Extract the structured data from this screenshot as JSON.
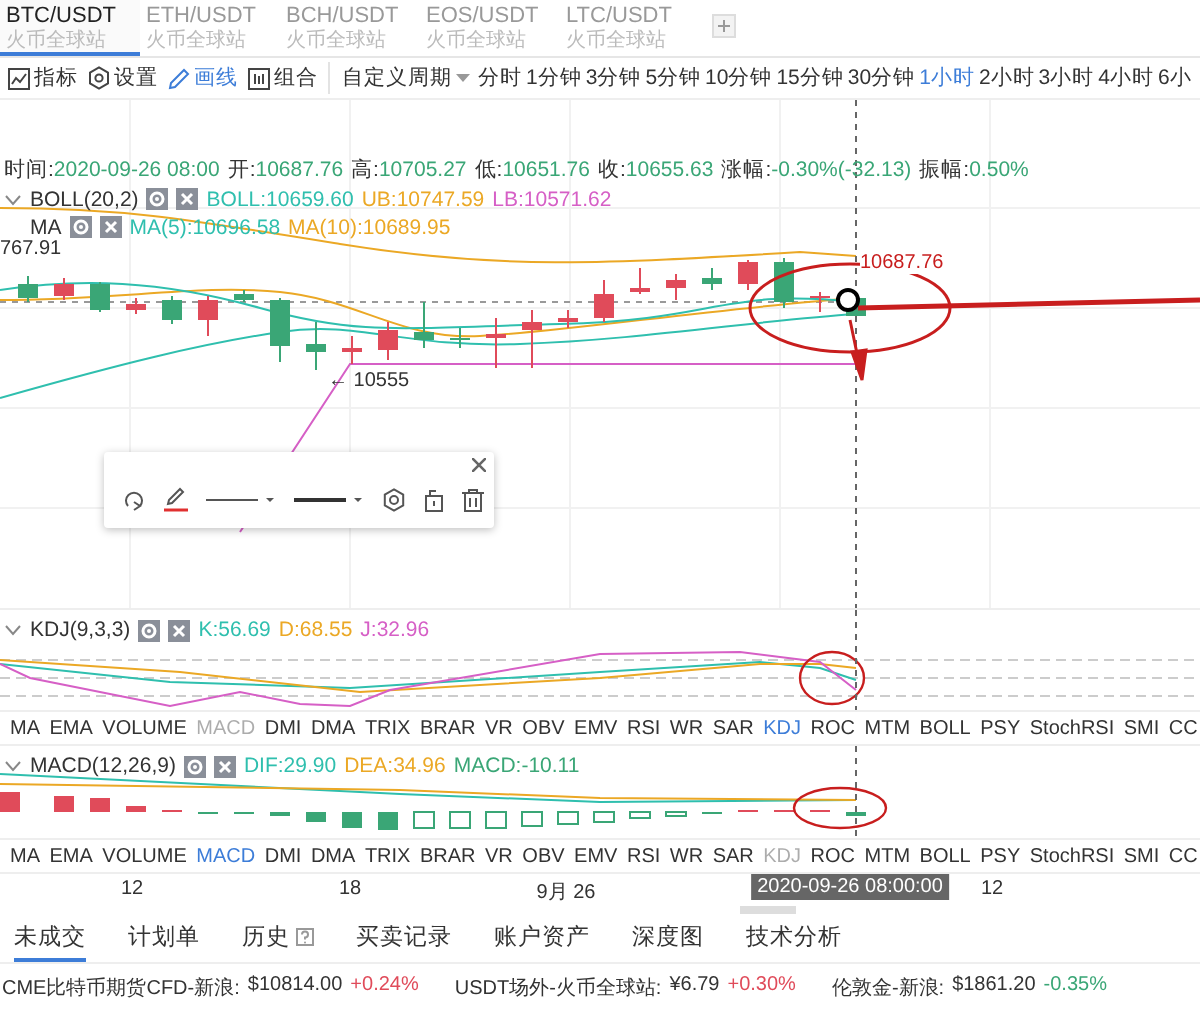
{
  "pair_tabs": [
    {
      "symbol": "BTC/USDT",
      "exchange": "火币全球站",
      "selected": true
    },
    {
      "symbol": "ETH/USDT",
      "exchange": "火币全球站",
      "selected": false
    },
    {
      "symbol": "BCH/USDT",
      "exchange": "火币全球站",
      "selected": false
    },
    {
      "symbol": "EOS/USDT",
      "exchange": "火币全球站",
      "selected": false
    },
    {
      "symbol": "LTC/USDT",
      "exchange": "火币全球站",
      "selected": false
    }
  ],
  "toolbar": {
    "tools": [
      {
        "kind": "indicators",
        "label": "指标",
        "selected": false
      },
      {
        "kind": "settings",
        "label": "设置",
        "selected": false
      },
      {
        "kind": "draw",
        "label": "画线",
        "selected": true
      },
      {
        "kind": "layout",
        "label": "组合",
        "selected": false
      }
    ],
    "custom_period": "自定义周期",
    "periods": [
      {
        "label": "分时",
        "selected": false
      },
      {
        "label": "1分钟",
        "selected": false
      },
      {
        "label": "3分钟",
        "selected": false
      },
      {
        "label": "5分钟",
        "selected": false
      },
      {
        "label": "10分钟",
        "selected": false
      },
      {
        "label": "15分钟",
        "selected": false
      },
      {
        "label": "30分钟",
        "selected": false
      },
      {
        "label": "1小时",
        "selected": true
      },
      {
        "label": "2小时",
        "selected": false
      },
      {
        "label": "3小时",
        "selected": false
      },
      {
        "label": "4小时",
        "selected": false
      },
      {
        "label": "6小",
        "selected": false
      }
    ]
  },
  "chart": {
    "info": [
      {
        "label": "时间:",
        "value": "2020-09-26 08:00"
      },
      {
        "label": "开:",
        "value": "10687.76"
      },
      {
        "label": "高:",
        "value": "10705.27"
      },
      {
        "label": "低:",
        "value": "10651.76"
      },
      {
        "label": "收:",
        "value": "10655.63"
      },
      {
        "label": "涨幅:",
        "value": "-0.30%(-32.13)"
      },
      {
        "label": "振幅:",
        "value": "0.50%"
      }
    ],
    "overlays": [
      {
        "name": "BOLL(20,2)",
        "collapsible": true,
        "values": [
          {
            "text": "BOLL:10659.60",
            "color": "#2fbfae"
          },
          {
            "text": "UB:10747.59",
            "color": "#eba825"
          },
          {
            "text": "LB:10571.62",
            "color": "#d65fc6"
          }
        ]
      },
      {
        "name": "MA",
        "collapsible": false,
        "values": [
          {
            "text": "MA(5):10696.58",
            "color": "#2fbfae"
          },
          {
            "text": "MA(10):10689.95",
            "color": "#eba825"
          }
        ]
      }
    ],
    "left_price": "767.91",
    "low_marker": "← 10555",
    "line_price": "10687.76"
  },
  "kdj_panel": {
    "name": "KDJ(9,3,3)",
    "collapsible": true,
    "values": [
      {
        "text": "K:56.69",
        "color": "#2fbfae"
      },
      {
        "text": "D:68.55",
        "color": "#eba825"
      },
      {
        "text": "J:32.96",
        "color": "#d65fc6"
      }
    ]
  },
  "indicator_tabs_top": [
    {
      "label": "MA",
      "selected": false,
      "disabled": false
    },
    {
      "label": "EMA",
      "selected": false,
      "disabled": false
    },
    {
      "label": "VOLUME",
      "selected": false,
      "disabled": false
    },
    {
      "label": "MACD",
      "selected": false,
      "disabled": true
    },
    {
      "label": "DMI",
      "selected": false,
      "disabled": false
    },
    {
      "label": "DMA",
      "selected": false,
      "disabled": false
    },
    {
      "label": "TRIX",
      "selected": false,
      "disabled": false
    },
    {
      "label": "BRAR",
      "selected": false,
      "disabled": false
    },
    {
      "label": "VR",
      "selected": false,
      "disabled": false
    },
    {
      "label": "OBV",
      "selected": false,
      "disabled": false
    },
    {
      "label": "EMV",
      "selected": false,
      "disabled": false
    },
    {
      "label": "RSI",
      "selected": false,
      "disabled": false
    },
    {
      "label": "WR",
      "selected": false,
      "disabled": false
    },
    {
      "label": "SAR",
      "selected": false,
      "disabled": false
    },
    {
      "label": "KDJ",
      "selected": true,
      "disabled": false
    },
    {
      "label": "ROC",
      "selected": false,
      "disabled": false
    },
    {
      "label": "MTM",
      "selected": false,
      "disabled": false
    },
    {
      "label": "BOLL",
      "selected": false,
      "disabled": false
    },
    {
      "label": "PSY",
      "selected": false,
      "disabled": false
    },
    {
      "label": "StochRSI",
      "selected": false,
      "disabled": false
    },
    {
      "label": "SMI",
      "selected": false,
      "disabled": false
    },
    {
      "label": "CC",
      "selected": false,
      "disabled": false
    }
  ],
  "macd_panel": {
    "name": "MACD(12,26,9)",
    "collapsible": true,
    "values": [
      {
        "text": "DIF:29.90",
        "color": "#2fbfae"
      },
      {
        "text": "DEA:34.96",
        "color": "#eba825"
      },
      {
        "text": "MACD:-10.11",
        "color": "#3aa676"
      }
    ]
  },
  "indicator_tabs_bottom": [
    {
      "label": "MA",
      "selected": false,
      "disabled": false
    },
    {
      "label": "EMA",
      "selected": false,
      "disabled": false
    },
    {
      "label": "VOLUME",
      "selected": false,
      "disabled": false
    },
    {
      "label": "MACD",
      "selected": true,
      "disabled": false
    },
    {
      "label": "DMI",
      "selected": false,
      "disabled": false
    },
    {
      "label": "DMA",
      "selected": false,
      "disabled": false
    },
    {
      "label": "TRIX",
      "selected": false,
      "disabled": false
    },
    {
      "label": "BRAR",
      "selected": false,
      "disabled": false
    },
    {
      "label": "VR",
      "selected": false,
      "disabled": false
    },
    {
      "label": "OBV",
      "selected": false,
      "disabled": false
    },
    {
      "label": "EMV",
      "selected": false,
      "disabled": false
    },
    {
      "label": "RSI",
      "selected": false,
      "disabled": false
    },
    {
      "label": "WR",
      "selected": false,
      "disabled": false
    },
    {
      "label": "SAR",
      "selected": false,
      "disabled": false
    },
    {
      "label": "KDJ",
      "selected": false,
      "disabled": true
    },
    {
      "label": "ROC",
      "selected": false,
      "disabled": false
    },
    {
      "label": "MTM",
      "selected": false,
      "disabled": false
    },
    {
      "label": "BOLL",
      "selected": false,
      "disabled": false
    },
    {
      "label": "PSY",
      "selected": false,
      "disabled": false
    },
    {
      "label": "StochRSI",
      "selected": false,
      "disabled": false
    },
    {
      "label": "SMI",
      "selected": false,
      "disabled": false
    },
    {
      "label": "CC",
      "selected": false,
      "disabled": false
    }
  ],
  "x_axis": [
    {
      "label": "12",
      "kind": "tick"
    },
    {
      "label": "18",
      "kind": "tick"
    },
    {
      "label": "9月 26",
      "kind": "tick"
    },
    {
      "label": "2020-09-26 08:00:00",
      "kind": "crosshair"
    },
    {
      "label": "12",
      "kind": "tick"
    }
  ],
  "bottom_tabs": [
    {
      "label": "未成交",
      "selected": true,
      "help": false
    },
    {
      "label": "计划单",
      "selected": false,
      "help": false
    },
    {
      "label": "历史",
      "selected": false,
      "help": true
    },
    {
      "label": "买卖记录",
      "selected": false,
      "help": false
    },
    {
      "label": "账户资产",
      "selected": false,
      "help": false
    },
    {
      "label": "深度图",
      "selected": false,
      "help": false
    },
    {
      "label": "技术分析",
      "selected": false,
      "help": false
    }
  ],
  "ticker": [
    {
      "name": "CME比特币期货CFD-新浪:",
      "price": "$10814.00",
      "change": "+0.24%",
      "color": "#e04b5a"
    },
    {
      "name": "USDT场外-火币全球站:",
      "price": "¥6.79",
      "change": "+0.30%",
      "color": "#e04b5a"
    },
    {
      "name": "伦敦金-新浪:",
      "price": "$1861.20",
      "change": "-0.35%",
      "color": "#3aa676"
    }
  ]
}
